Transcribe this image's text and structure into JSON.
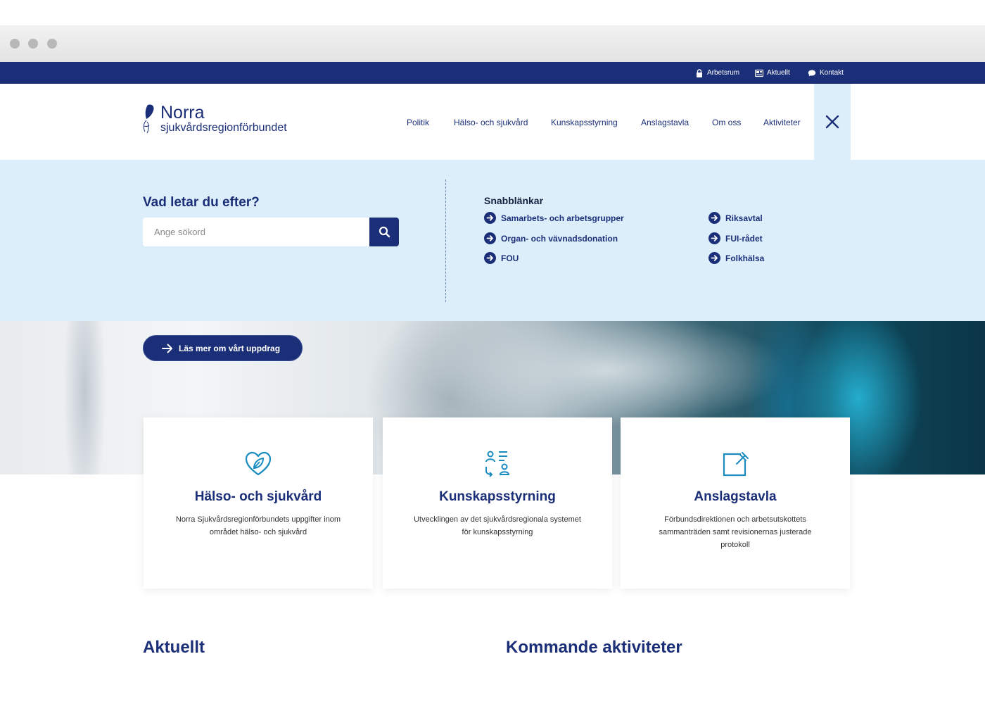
{
  "topbar": {
    "links": [
      {
        "label": "Arbetsrum",
        "icon": "lock-icon"
      },
      {
        "label": "Aktuellt",
        "icon": "newspaper-icon"
      },
      {
        "label": "Kontakt",
        "icon": "chat-icon"
      }
    ]
  },
  "header": {
    "logo_title": "Norra",
    "logo_subtitle": "sjukvårdsregionförbundet",
    "nav": [
      "Politik",
      "Hälso- och sjukvård",
      "Kunskapsstyrning",
      "Anslagstavla",
      "Om oss",
      "Aktiviteter"
    ],
    "close_icon": "close-icon"
  },
  "search": {
    "heading": "Vad letar du efter?",
    "placeholder": "Ange sökord",
    "value": ""
  },
  "quicklinks": {
    "heading": "Snabblänkar",
    "items": [
      "Samarbets- och arbetsgrupper",
      "Organ- och vävnadsdonation",
      "FOU",
      "Riksavtal",
      "FUI-rådet",
      "Folkhälsa"
    ]
  },
  "hero": {
    "cta_label": "Läs mer om vårt uppdrag"
  },
  "cards": [
    {
      "title": "Hälso- och sjukvård",
      "desc": "Norra Sjukvårdsregionförbundets uppgifter inom området hälso- och sjukvård",
      "icon": "heart-leaf-icon"
    },
    {
      "title": "Kunskapsstyrning",
      "desc": "Utvecklingen av det sjukvårdsregionala systemet för kunskapsstyrning",
      "icon": "people-list-icon"
    },
    {
      "title": "Anslagstavla",
      "desc": "Förbundsdirektionen och arbetsutskottets sammanträden samt revisionernas justerade protokoll",
      "icon": "notice-board-icon"
    }
  ],
  "sections": {
    "news_heading": "Aktuellt",
    "events_heading": "Kommande aktiviteter"
  },
  "colors": {
    "navy": "#1b2f78",
    "panel": "#ddeefb",
    "accent_icon": "#1a8cc0"
  }
}
